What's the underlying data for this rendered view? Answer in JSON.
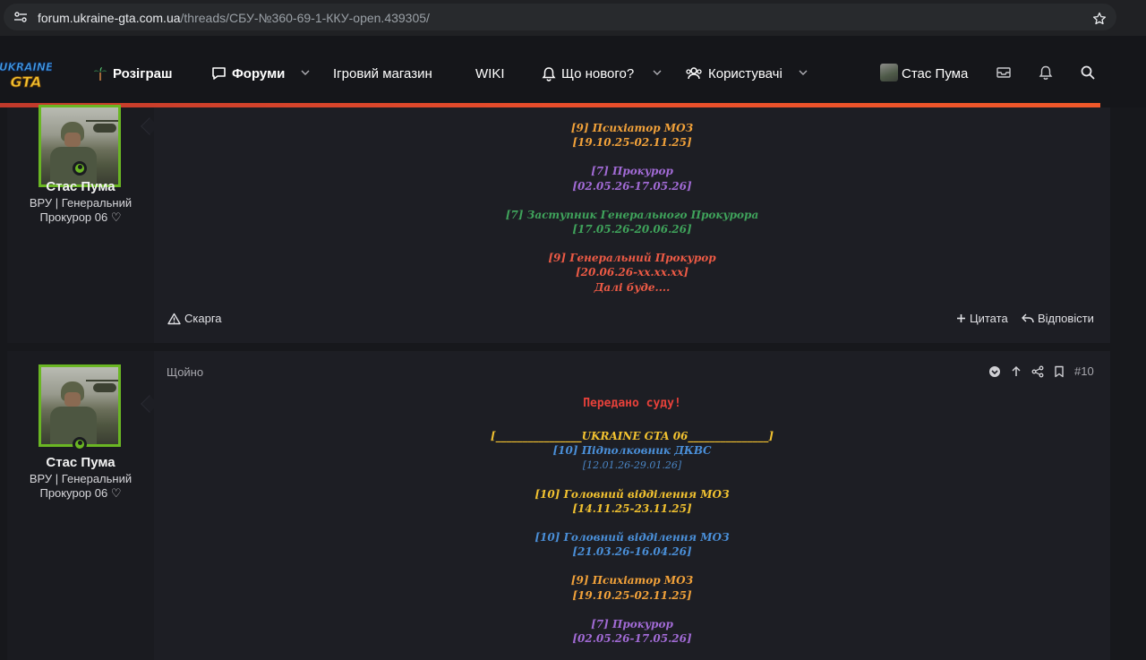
{
  "browser": {
    "url_host": "forum.ukraine-gta.com.ua",
    "url_path": "/threads/СБУ-№360-69-1-ККУ-open.439305/"
  },
  "nav": {
    "logo_text": "UKRAINE GTA",
    "giveaway": "Розіграш",
    "forums": "Форуми",
    "shop": "Ігровий магазин",
    "wiki": "WIKI",
    "whats_new": "Що нового?",
    "users": "Користувачі",
    "username": "Стас Пума"
  },
  "posts": [
    {
      "author": "Стас Пума",
      "title_line1": "ВРУ | Генеральний",
      "title_line2": "Прокурор 06 ♡",
      "lines": [
        {
          "text": "[9] Психіатор МОЗ",
          "color": "orange"
        },
        {
          "text": "[19.10.25-02.11.25]",
          "color": "orange"
        },
        {
          "text": "[7] Прокурор",
          "color": "purple"
        },
        {
          "text": "[02.05.26-17.05.26]",
          "color": "purple"
        },
        {
          "text": "[7] Заступник Генерального Прокурора",
          "color": "green"
        },
        {
          "text": "[17.05.26-20.06.26]",
          "color": "green"
        },
        {
          "text": "[9] Генеральний Прокурор",
          "color": "red"
        },
        {
          "text": "[20.06.26-xx.xx.xx]",
          "color": "red"
        },
        {
          "text": "Далі буде....",
          "color": "red"
        }
      ],
      "report": "Скарга",
      "quote": "Цитата",
      "reply": "Відповісти"
    },
    {
      "author": "Стас Пума",
      "title_line1": "ВРУ | Генеральний",
      "title_line2": "Прокурор 06 ♡",
      "time": "Щойно",
      "number": "#10",
      "heading": "Передано суду!",
      "banner": "[________________UKRAINE GTA 06_______________]",
      "lines": [
        {
          "text": "[10] Підполковник ДКВС",
          "color": "blue"
        },
        {
          "text": "[12.01.26-29.01.26]",
          "color": "blue-dim"
        },
        {
          "text": "[10] Головний відділення МОЗ",
          "color": "yellow"
        },
        {
          "text": "[14.11.25-23.11.25]",
          "color": "yellow"
        },
        {
          "text": "[10] Головний відділення МОЗ",
          "color": "blue"
        },
        {
          "text": "[21.03.26-16.04.26]",
          "color": "blue"
        },
        {
          "text": "[9] Психіатор МОЗ",
          "color": "orange"
        },
        {
          "text": "[19.10.25-02.11.25]",
          "color": "orange"
        },
        {
          "text": "[7] Прокурор",
          "color": "purple"
        },
        {
          "text": "[02.05.26-17.05.26]",
          "color": "purple"
        }
      ]
    }
  ]
}
